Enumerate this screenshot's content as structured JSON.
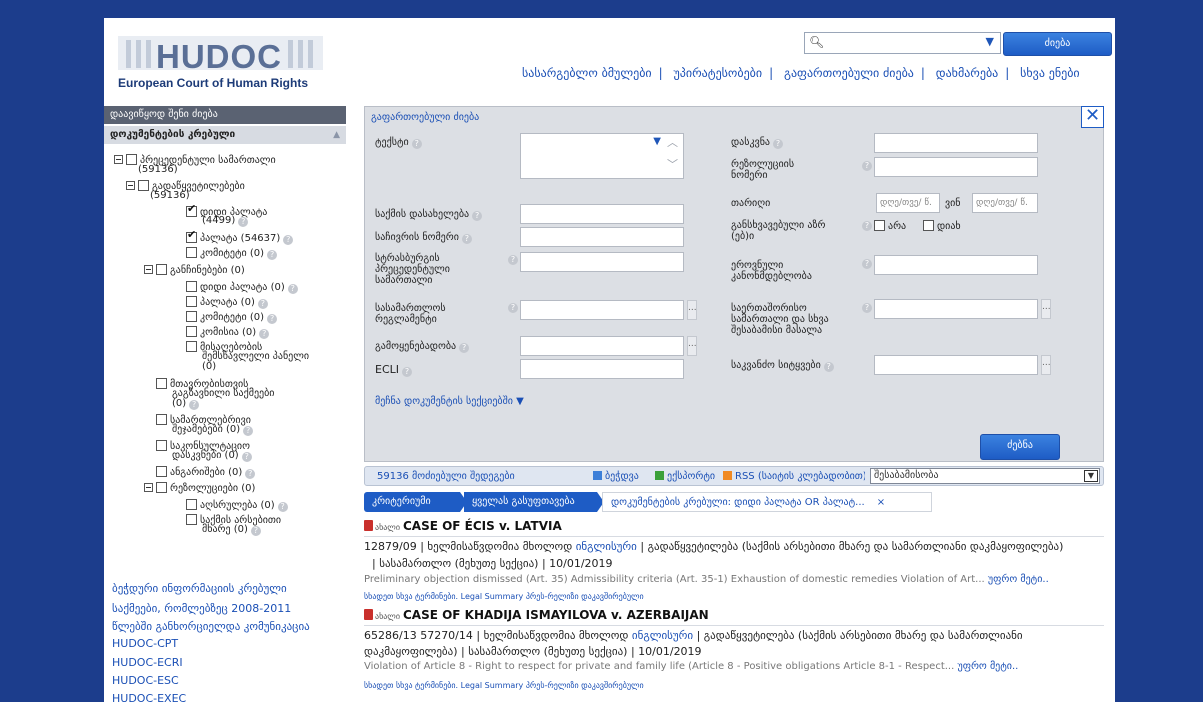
{
  "logo": {
    "word": "HUDOC",
    "subtitle": "European Court of Human Rights"
  },
  "top": {
    "search_button": "ძიება",
    "links": [
      "სასარგებლო ბმულები",
      "უპირატესობები",
      "გაფართოებული ძიება",
      "დახმარება",
      "სხვა ენები"
    ]
  },
  "sidebar": {
    "header1": "დაავიწყოდ შენი ძიება",
    "header2": "დოკუმენტების კრებული",
    "tree": {
      "n1": "პრეცედენტული სამართალი",
      "n1c": "(59136)",
      "n2": "გადაწყვეტილებები",
      "n2c": "(59136)",
      "n3": "დიდი პალატა",
      "n3c": "(4499)",
      "n4": "პალატა (54637)",
      "n5": "კომიტეტი (0)",
      "n6": "განჩინებები (0)",
      "n7": "დიდი პალატა (0)",
      "n8": "პალატა (0)",
      "n9": "კომიტეტი (0)",
      "n10": "კომისია (0)",
      "n11": "მისაღებობის",
      "n11b": "შემსწავლელი პანელი",
      "n11c": "(0)",
      "n12": "მთავრობისთვის",
      "n12b": "გაგზავნილი საქმეები",
      "n12c": "(0)",
      "n13": "სამართლებრივი",
      "n13b": "შეჯამებები (0)",
      "n14": "საკონსულტაციო",
      "n14b": "დასკვნები (0)",
      "n15": "ანგარიშები (0)",
      "n16": "რეზოლუციები (0)",
      "n17": "აღსრულება (0)",
      "n18": "საქმის არსებითი",
      "n18b": "მხარე (0)"
    },
    "links": [
      "ბეჭდური ინფორმაციის კრებული",
      "საქმეები, რომლებზეც 2008-2011",
      "წლებში განხორციელდა კომუნიკაცია",
      "HUDOC-CPT",
      "HUDOC-ECRI",
      "HUDOC-ESC",
      "HUDOC-EXEC"
    ]
  },
  "panel": {
    "title": "გაფართოებული ძიება",
    "close": "✕",
    "text_label": "ტექსტი",
    "case_title": "საქმის დასახელება",
    "app_number": "საჩივრის ნომერი",
    "strasbourg": [
      "სტრასბურგის",
      "პრეცედენტული",
      "სამართალი"
    ],
    "rules": [
      "სასამართლოს",
      "რეგლამენტი"
    ],
    "applicability": "გამოყენებადობა",
    "ecli": "ECLI",
    "conclusion": "დასკვნა",
    "resolution": [
      "რეზოლუციის",
      "ნომერი"
    ],
    "date": "თარიღი",
    "date_from": "დღე/თვე/ წ.",
    "date_to_label": "ვინ",
    "date_to": "დღე/თვე/ წ.",
    "separate_opinion": [
      "განსხვავებული აზრ",
      "(ებ)ი"
    ],
    "opt_no": "არა",
    "opt_yes": "დიახ",
    "domestic_law": [
      "ეროვნული",
      "კანონმდებლობა"
    ],
    "intl_law": [
      "საერთაშორისო",
      "სამართალი და სხვა",
      "შესაბამისი მასალა"
    ],
    "keywords": "საკვანძო სიტყვები",
    "show_columns": "მეჩნა  დოკუმენტის სექციებში ▼",
    "search_button": "ძებნა",
    "dots": "..."
  },
  "results_bar": {
    "count": "59136 მოძიებული შედეგები",
    "print": "ბეჭდვა",
    "export": "ექსპორტი",
    "rss": "RSS (საიტის კლებადობით)",
    "sort": "შესაბამისობა"
  },
  "crumbs": {
    "c1": "კრიტერიუმი",
    "c2": "ყველას გასუფთავება",
    "c3": "დოკუმენტების კრებული: დიდი პალატა OR პალატ...",
    "x": "×"
  },
  "results": [
    {
      "tag": "ახალი",
      "title": "CASE OF ÉCIS v. LATVIA",
      "meta1a": "12879/09  |  ხელმისაწვდომია მხოლოდ ",
      "meta1b": "ინგლისური",
      "meta1c": "  |  გადაწყვეტილება (საქმის არსებითი მხარე და სამართლიანი დაკმაყოფილება)",
      "meta2": "|  სასამართლო (მეხუთე სექცია)  |  10/01/2019",
      "summary": "Preliminary objection dismissed (Art. 35) Admissibility criteria (Art. 35-1) Exhaustion of domestic remedies Violation of Art... ",
      "more": "უფრო მეტი..",
      "links": "სხადეთ სხვა ტერმინები.  Legal Summary  პრეს-რელიზი  დაკავშირებული"
    },
    {
      "tag": "ახალი",
      "title": "CASE OF KHADIJA ISMAYILOVA v. AZERBAIJAN",
      "meta1a": "65286/13 57270/14  |  ხელმისაწვდომია მხოლოდ ",
      "meta1b": "ინგლისური",
      "meta1c": "  |  გადაწყვეტილება (საქმის არსებითი მხარე და სამართლიანი",
      "meta2": "დაკმაყოფილება)  |  სასამართლო (მეხუთე სექცია)  |  10/01/2019",
      "summary": "Violation of Article 8 - Right to respect for private and family life (Article 8 - Positive obligations Article 8-1 - Respect... ",
      "more": "უფრო მეტი..",
      "links": "სხადეთ სხვა ტერმინები.  Legal Summary  პრეს-რელიზი  დაკავშირებული"
    }
  ]
}
